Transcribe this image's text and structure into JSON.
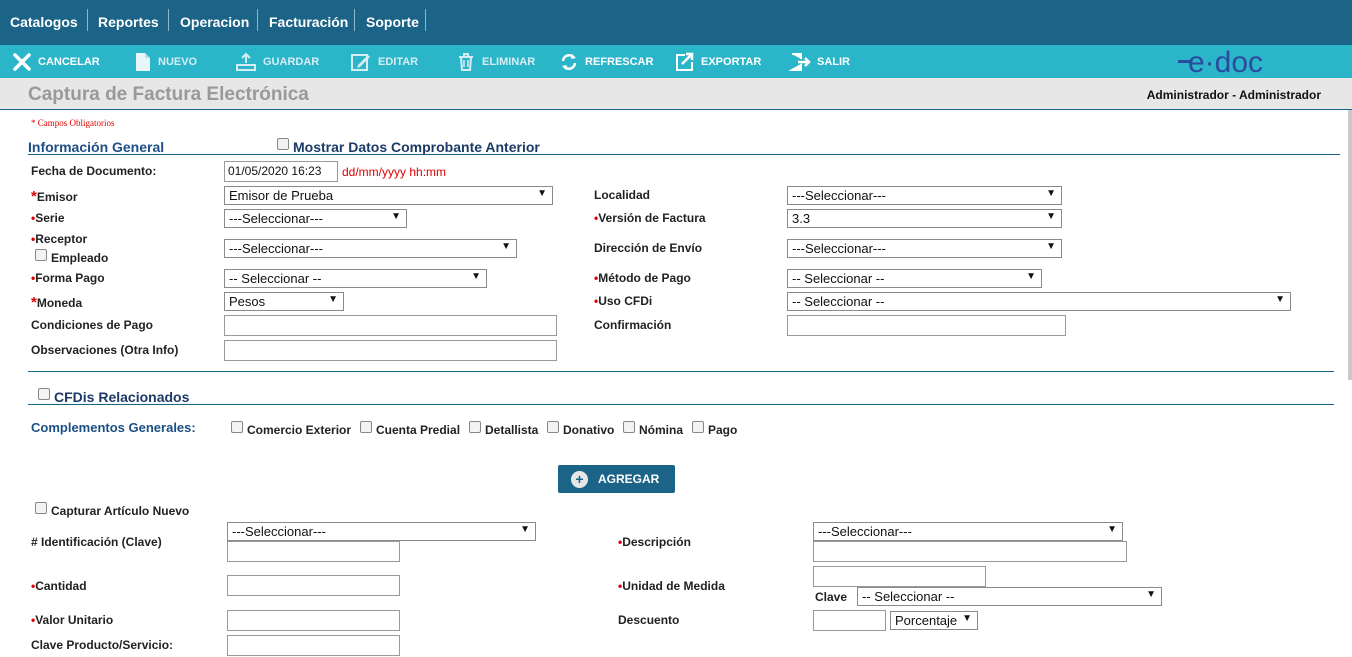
{
  "menu": [
    "Catalogos",
    "Reportes",
    "Operacion",
    "Facturación",
    "Soporte"
  ],
  "toolbar": {
    "cancel": "CANCELAR",
    "new": "NUEVO",
    "save": "GUARDAR",
    "edit": "EDITAR",
    "delete": "ELIMINAR",
    "refresh": "REFRESCAR",
    "export": "EXPORTAR",
    "exit": "SALIR"
  },
  "logo": "e·doc",
  "page": {
    "title": "Captura de Factura Electrónica",
    "user": "Administrador - Administrador"
  },
  "required_note": "* Campos Obligatorios",
  "general": {
    "section": "Información General",
    "show_prev": "Mostrar Datos Comprobante Anterior",
    "fecha_label": "Fecha de Documento:",
    "fecha_value": "01/05/2020 16:23",
    "fecha_hint": "dd/mm/yyyy hh:mm",
    "emisor_label": "Emisor",
    "emisor_value": "Emisor de Prueba",
    "serie_label": "Serie",
    "serie_value": "---Seleccionar---",
    "receptor_label": "Receptor",
    "empleado_label": "Empleado",
    "receptor_value": "---Seleccionar---",
    "forma_label": "Forma Pago",
    "forma_value": "-- Seleccionar --",
    "moneda_label": "Moneda",
    "moneda_value": "Pesos",
    "condiciones_label": "Condiciones de Pago",
    "condiciones_value": "",
    "observaciones_label": "Observaciones (Otra Info)",
    "observaciones_value": "",
    "localidad_label": "Localidad",
    "localidad_value": "---Seleccionar---",
    "version_label": "Versión de Factura",
    "version_value": "3.3",
    "direccion_label": "Dirección de Envío",
    "direccion_value": "---Seleccionar---",
    "metodo_label": "Método de Pago",
    "metodo_value": "-- Seleccionar --",
    "uso_label": "Uso CFDi",
    "uso_value": "-- Seleccionar --",
    "confirmacion_label": "Confirmación",
    "confirmacion_value": ""
  },
  "relacionados": "CFDis Relacionados",
  "complementos": {
    "label": "Complementos Generales:",
    "items": [
      "Comercio Exterior",
      "Cuenta Predial",
      "Detallista",
      "Donativo",
      "Nómina",
      "Pago"
    ]
  },
  "agregar": "AGREGAR",
  "articulo": {
    "nuevo_label": "Capturar Artículo Nuevo",
    "id_label": "# Identificación (Clave)",
    "id_select": "---Seleccionar---",
    "id_value": "",
    "desc_label": "Descripción",
    "desc_select": "---Seleccionar---",
    "desc_value": "",
    "cantidad_label": "Cantidad",
    "cantidad_value": "",
    "unidad_label": "Unidad de Medida",
    "unidad_value": "",
    "clave_label": "Clave",
    "clave_value": "-- Seleccionar --",
    "valor_label": "Valor Unitario",
    "valor_value": "",
    "descuento_label": "Descuento",
    "descuento_value": "",
    "descuento_tipo": "Porcentaje",
    "producto_label": "Clave Producto/Servicio:",
    "producto_value": ""
  }
}
